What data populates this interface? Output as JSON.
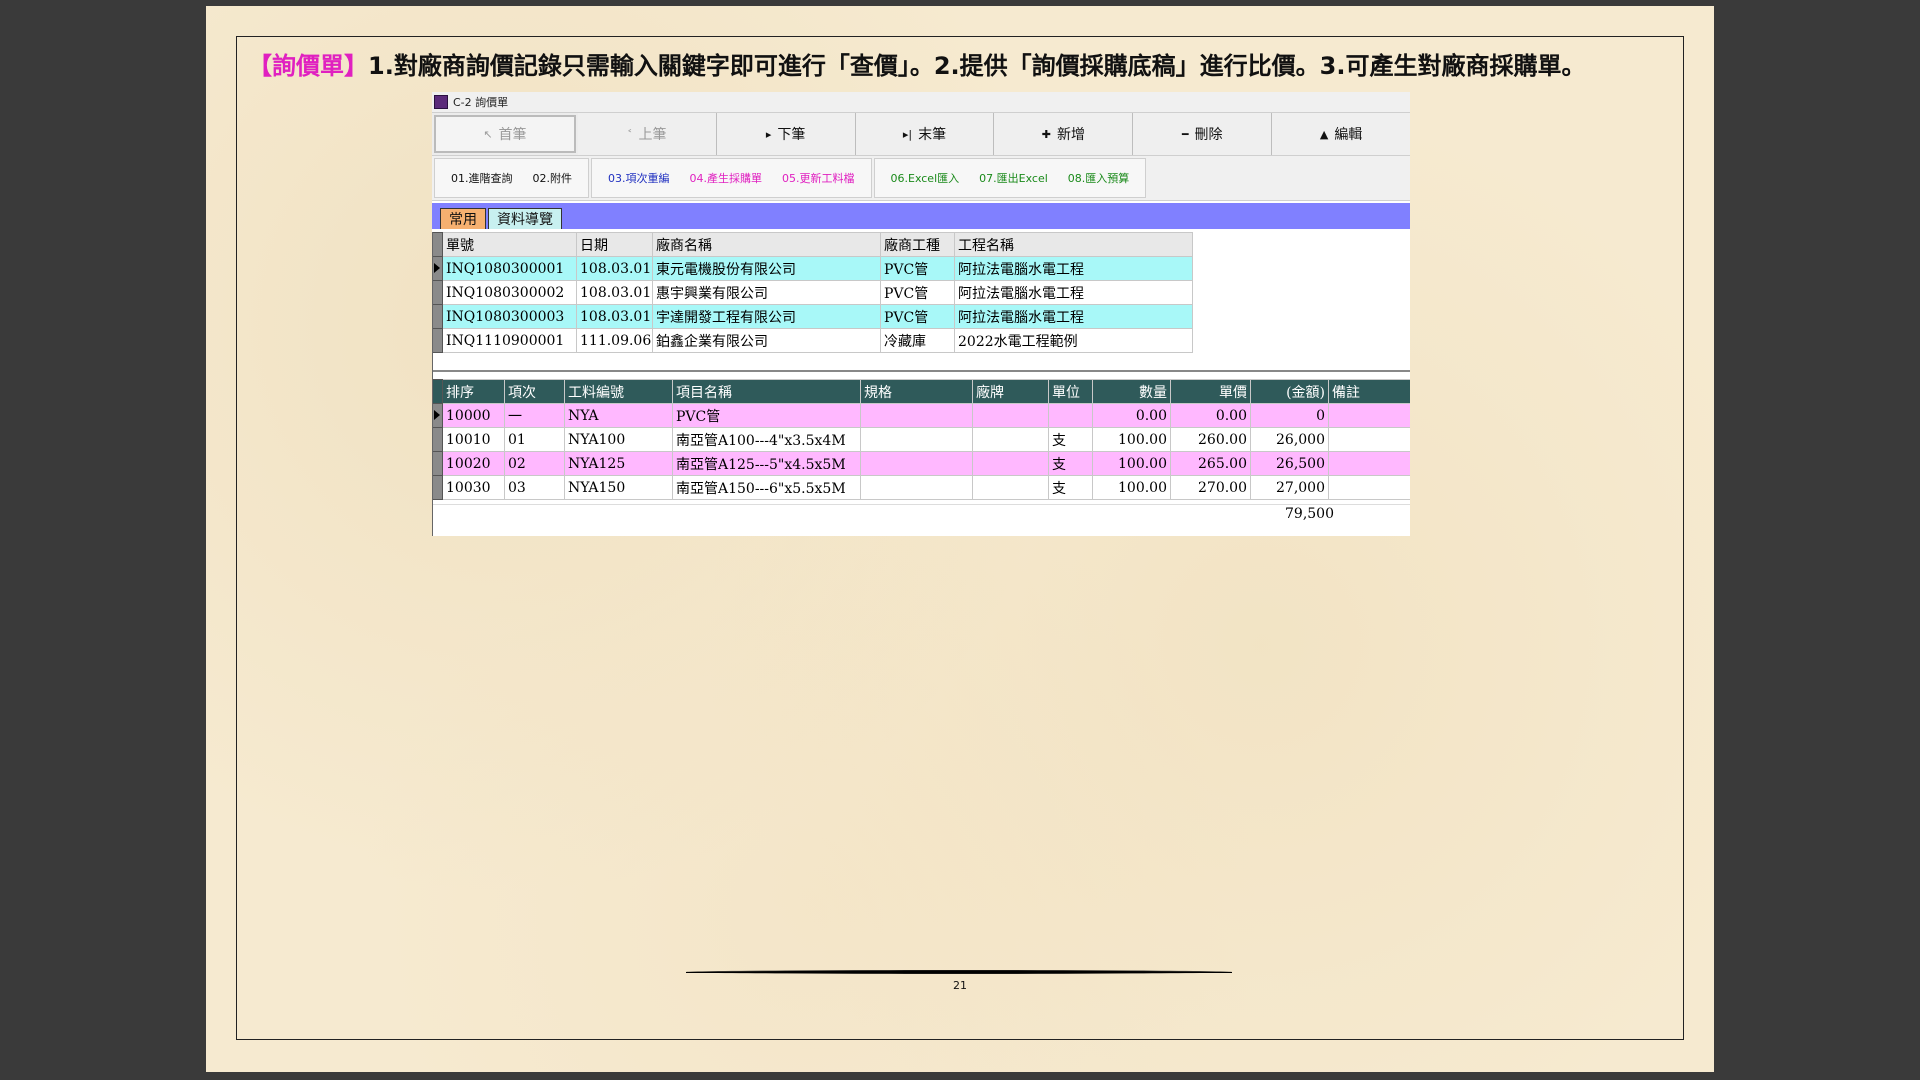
{
  "headline": {
    "tag": "【詢價單】",
    "text": "1.對廠商詢價記錄只需輸入關鍵字即可進行「查價」。2.提供「詢價採購底稿」進行比價。3.可產生對廠商採購單。"
  },
  "window": {
    "title": "C-2 詢價單",
    "nav": [
      {
        "label": "首筆",
        "icon": "↖"
      },
      {
        "label": "上筆",
        "icon": "˂"
      },
      {
        "label": "下筆",
        "icon": "▸"
      },
      {
        "label": "末筆",
        "icon": "▸|"
      },
      {
        "label": "新增",
        "icon": "✚"
      },
      {
        "label": "刪除",
        "icon": "━"
      },
      {
        "label": "編輯",
        "icon": "▲"
      }
    ],
    "functions": {
      "group1": [
        "01.進階查詢",
        "02.附件"
      ],
      "group2": [
        "03.項次重編",
        "04.產生採購單",
        "05.更新工料檔"
      ],
      "group3": [
        "06.Excel匯入",
        "07.匯出Excel",
        "08.匯入預算"
      ]
    },
    "tabs": [
      "常用",
      "資料導覽"
    ],
    "master": {
      "headers": [
        "單號",
        "日期",
        "廠商名稱",
        "廠商工種",
        "工程名稱"
      ],
      "rows": [
        [
          "INQ1080300001",
          "108.03.01",
          "東元電機股份有限公司",
          "PVC管",
          "阿拉法電腦水電工程"
        ],
        [
          "INQ1080300002",
          "108.03.01",
          "惠宇興業有限公司",
          "PVC管",
          "阿拉法電腦水電工程"
        ],
        [
          "INQ1080300003",
          "108.03.01",
          "宇達開發工程有限公司",
          "PVC管",
          "阿拉法電腦水電工程"
        ],
        [
          "INQ1110900001",
          "111.09.06",
          "鉑鑫企業有限公司",
          "冷藏庫",
          "2022水電工程範例"
        ]
      ]
    },
    "detail": {
      "headers": [
        "排序",
        "項次",
        "工料編號",
        "項目名稱",
        "規格",
        "廠牌",
        "單位",
        "數量",
        "單價",
        "(金額)",
        "備註"
      ],
      "rows": [
        [
          "10000",
          "一",
          "NYA",
          "PVC管",
          "",
          "",
          "",
          "0.00",
          "0.00",
          "0",
          ""
        ],
        [
          "10010",
          "01",
          "NYA100",
          "南亞管A100---4\"x3.5x4M",
          "",
          "",
          "支",
          "100.00",
          "260.00",
          "26,000",
          ""
        ],
        [
          "10020",
          "02",
          "NYA125",
          "南亞管A125---5\"x4.5x5M",
          "",
          "",
          "支",
          "100.00",
          "265.00",
          "26,500",
          ""
        ],
        [
          "10030",
          "03",
          "NYA150",
          "南亞管A150---6\"x5.5x5M",
          "",
          "",
          "支",
          "100.00",
          "270.00",
          "27,000",
          ""
        ]
      ],
      "total": "79,500"
    }
  },
  "page_number": "21"
}
